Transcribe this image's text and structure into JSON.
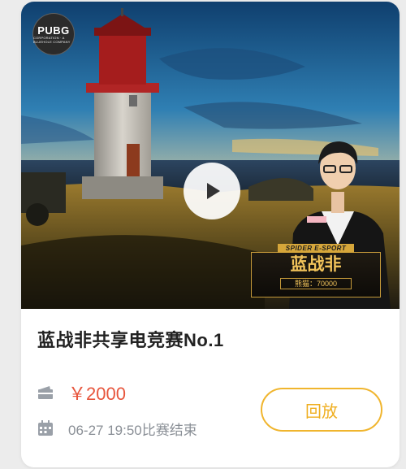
{
  "hero": {
    "logo": {
      "main": "PUBG",
      "sub": "CORPORATION · A BLUEHOLE COMPANY"
    },
    "banner": {
      "tag": "SPIDER E-SPORT",
      "name": "蓝战非",
      "room": "熊猫：70000"
    }
  },
  "card": {
    "title": "蓝战非共享电竞赛No.1",
    "price": "￥2000",
    "time": "06-27 19:50比赛结束",
    "replay_label": "回放"
  },
  "colors": {
    "accent": "#f0b52e",
    "price": "#e7553c",
    "muted": "#8a8f96"
  },
  "icons": {
    "price": "ticket-icon",
    "time": "calendar-icon",
    "play": "play-icon"
  }
}
